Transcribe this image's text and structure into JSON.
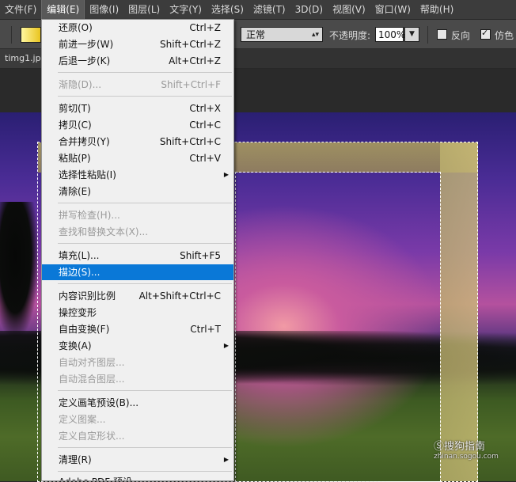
{
  "menubar": {
    "items": [
      "文件(F)",
      "编辑(E)",
      "图像(I)",
      "图层(L)",
      "文字(Y)",
      "选择(S)",
      "滤镜(T)",
      "3D(D)",
      "视图(V)",
      "窗口(W)",
      "帮助(H)"
    ]
  },
  "options": {
    "mode": "正常",
    "opacity_label": "不透明度:",
    "opacity_value": "100%",
    "reverse_label": "反向",
    "dither_label": "仿色"
  },
  "tab": {
    "filename": "timg1.jp"
  },
  "edit_menu": {
    "items": [
      {
        "label": "还原(O)",
        "shortcut": "Ctrl+Z"
      },
      {
        "label": "前进一步(W)",
        "shortcut": "Shift+Ctrl+Z"
      },
      {
        "label": "后退一步(K)",
        "shortcut": "Alt+Ctrl+Z"
      },
      {
        "label": "渐隐(D)...",
        "shortcut": "Shift+Ctrl+F"
      },
      {
        "label": "剪切(T)",
        "shortcut": "Ctrl+X"
      },
      {
        "label": "拷贝(C)",
        "shortcut": "Ctrl+C"
      },
      {
        "label": "合并拷贝(Y)",
        "shortcut": "Shift+Ctrl+C"
      },
      {
        "label": "粘贴(P)",
        "shortcut": "Ctrl+V"
      },
      {
        "label": "选择性粘贴(I)",
        "shortcut": ""
      },
      {
        "label": "清除(E)",
        "shortcut": ""
      },
      {
        "label": "拼写检查(H)...",
        "shortcut": ""
      },
      {
        "label": "查找和替换文本(X)...",
        "shortcut": ""
      },
      {
        "label": "填充(L)...",
        "shortcut": "Shift+F5"
      },
      {
        "label": "描边(S)...",
        "shortcut": ""
      },
      {
        "label": "内容识别比例",
        "shortcut": "Alt+Shift+Ctrl+C"
      },
      {
        "label": "操控变形",
        "shortcut": ""
      },
      {
        "label": "自由变换(F)",
        "shortcut": "Ctrl+T"
      },
      {
        "label": "变换(A)",
        "shortcut": ""
      },
      {
        "label": "自动对齐图层...",
        "shortcut": ""
      },
      {
        "label": "自动混合图层...",
        "shortcut": ""
      },
      {
        "label": "定义画笔预设(B)...",
        "shortcut": ""
      },
      {
        "label": "定义图案...",
        "shortcut": ""
      },
      {
        "label": "定义自定形状...",
        "shortcut": ""
      },
      {
        "label": "清理(R)",
        "shortcut": ""
      },
      {
        "label": "Adobe PDF 预设...",
        "shortcut": ""
      }
    ]
  },
  "watermark": {
    "text": "搜狗指南",
    "sub": "zhinan.sogou.com"
  }
}
